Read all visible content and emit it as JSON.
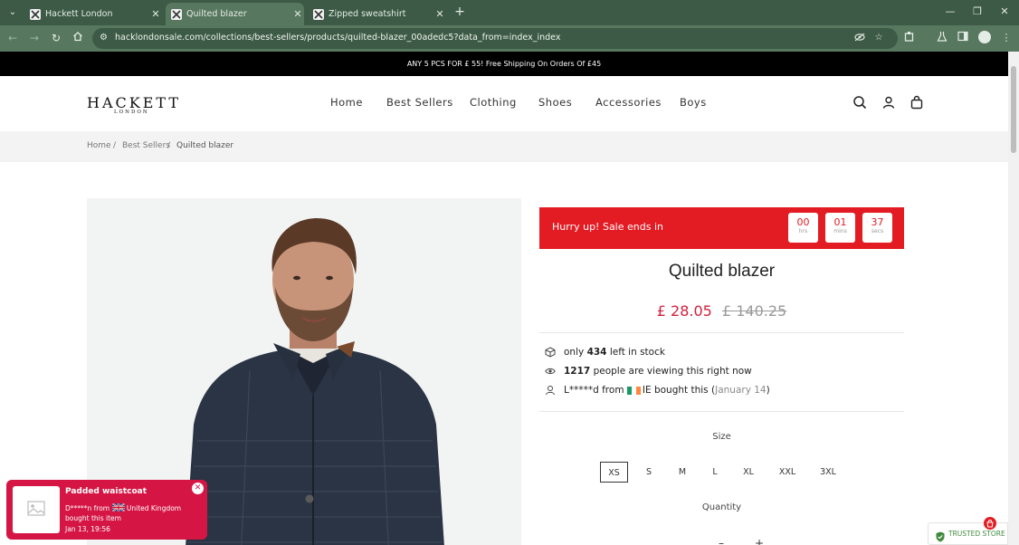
{
  "browser": {
    "tabs": [
      {
        "title": "Hackett London",
        "active": false
      },
      {
        "title": "Quilted blazer",
        "active": true
      },
      {
        "title": "Zipped sweatshirt",
        "active": false
      }
    ],
    "url": "hacklondonsale.com/collections/best-sellers/products/quilted-blazer_00adedc5?data_from=index_index",
    "icons": [
      "tab-search-icon",
      "close-icon",
      "new-tab-icon",
      "minimize-icon",
      "restore-icon",
      "back-icon",
      "forward-icon",
      "reload-icon",
      "home-icon",
      "site-info-icon",
      "eye-off-icon",
      "star-icon",
      "extensions-icon",
      "flask-icon",
      "sidebar-icon",
      "profile-icon",
      "more-icon"
    ]
  },
  "promo": {
    "text": "ANY 5 PCS FOR £ 55! Free Shipping On Orders Of £45"
  },
  "header": {
    "logo": {
      "main": "HACKETT",
      "sub": "LONDON"
    },
    "nav": [
      "Home",
      "Best Sellers",
      "Clothing",
      "Shoes",
      "Accessories",
      "Boys"
    ]
  },
  "breadcrumb": {
    "home": "Home",
    "sep": "/",
    "category": "Best Sellers",
    "current": "Quilted blazer"
  },
  "sale": {
    "text": "Hurry up!  Sale ends in",
    "hours": "00",
    "hours_label": "hrs",
    "mins": "01",
    "mins_label": "mins",
    "secs": "37",
    "secs_label": "secs",
    "color": "#e31b23"
  },
  "product": {
    "title": "Quilted blazer",
    "price": "£ 28.05",
    "old_price": "£ 140.25",
    "stock": {
      "pre": "only",
      "count": "434",
      "post": "left in stock"
    },
    "viewers": {
      "count": "1217",
      "post": "people are viewing this right now"
    },
    "recent": {
      "name": "L*****d",
      "from": "from",
      "country": "IE",
      "action": "bought this",
      "date_open": "(",
      "date": "January 14",
      "date_close": ")"
    },
    "size_label": "Size",
    "sizes": [
      "XS",
      "S",
      "M",
      "L",
      "XL",
      "XXL",
      "3XL"
    ],
    "selected_size": "XS",
    "quantity_label": "Quantity"
  },
  "toast": {
    "title": "Padded waistcoat",
    "buyer": "D*****n from",
    "country": "United Kingdom",
    "action": "bought this item",
    "time": "Jan 13, 19:56",
    "color": "#d51645"
  },
  "trust_badge": {
    "text": "TRUSTED STORE",
    "color": "#3f8a3d"
  }
}
